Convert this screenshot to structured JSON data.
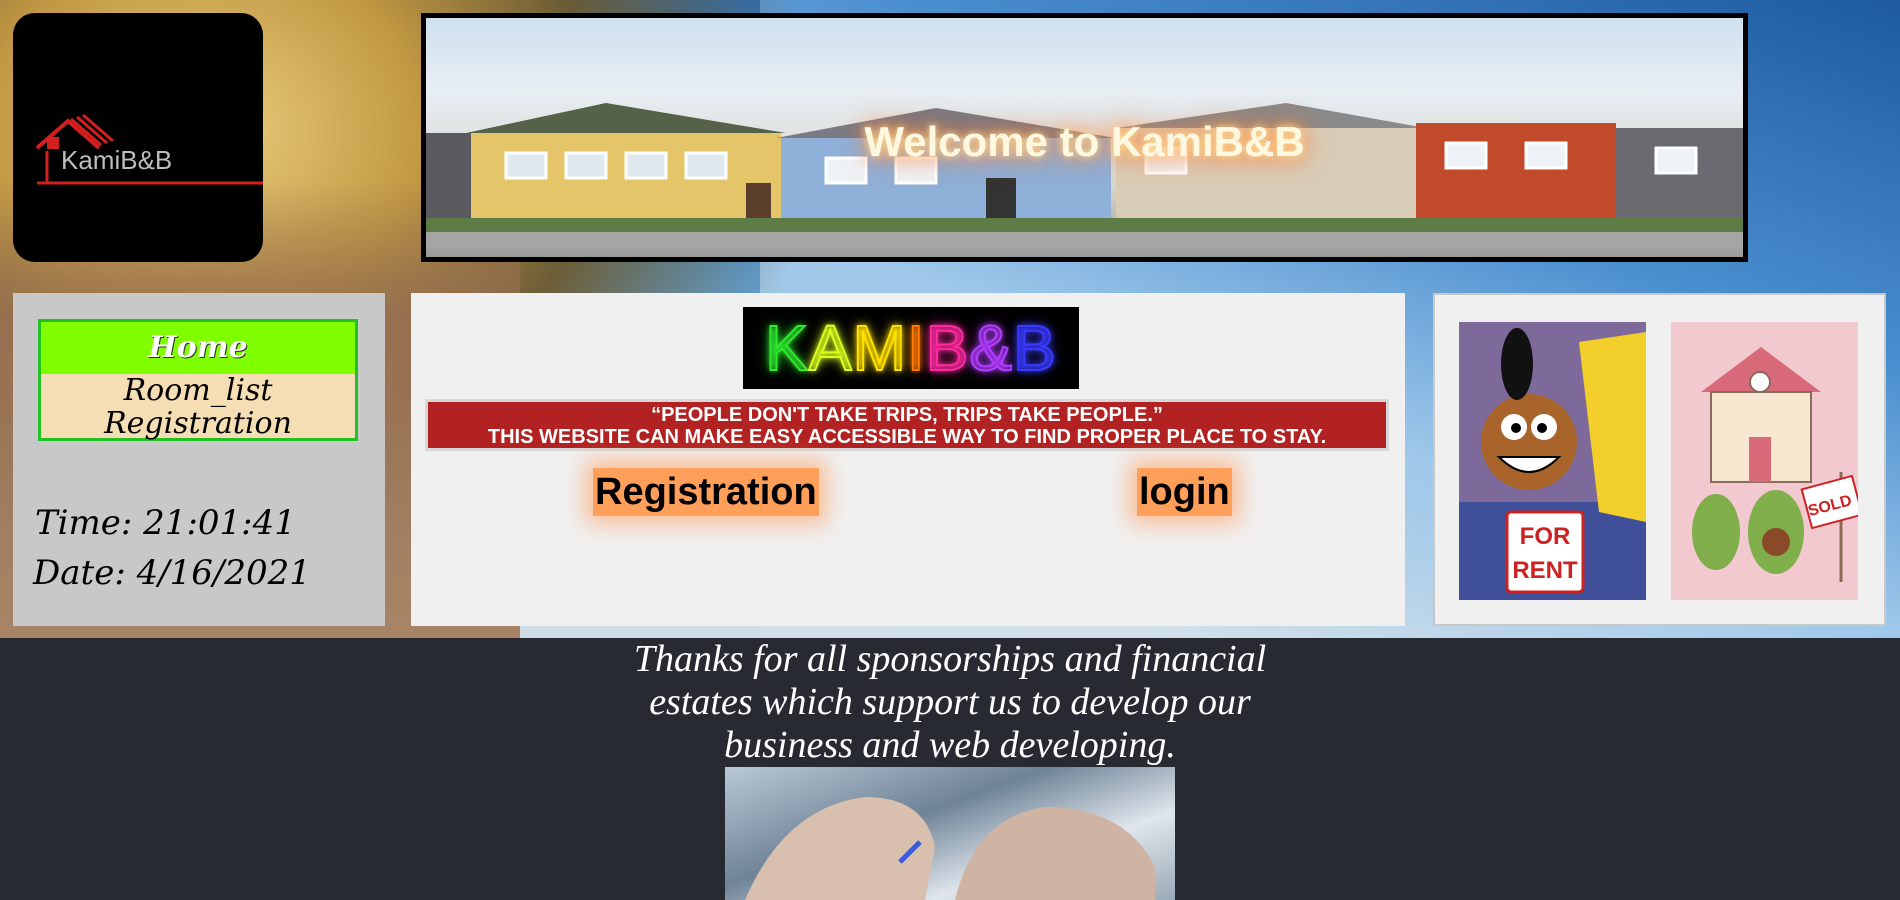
{
  "logo": {
    "text": "KamiB&B"
  },
  "banner": {
    "welcome": "Welcome to KamiB&B"
  },
  "nav": {
    "items": [
      {
        "label": "Home"
      },
      {
        "label": "Room_list"
      },
      {
        "label": "Registration"
      }
    ]
  },
  "clock": {
    "time": "Time: 21:01:41",
    "date": "Date: 4/16/2021"
  },
  "main": {
    "brand": [
      "K",
      "A",
      "M",
      "I",
      "B",
      "&",
      "B"
    ],
    "brand_colors": [
      "#2ee82e",
      "#d8ff20",
      "#ffe000",
      "#ff7a00",
      "#ff2aa0",
      "#b23cff",
      "#3a3aff"
    ],
    "quote_line1": "“PEOPLE DON'T TAKE TRIPS, TRIPS TAKE PEOPLE.”",
    "quote_line2": "THIS WEBSITE CAN MAKE EASY ACCESSIBLE WAY TO FIND PROPER PLACE TO STAY.",
    "register_button": "Registration",
    "login_button": "login"
  },
  "cards": {
    "rent_sign": "FOR RENT",
    "sold_sign": "SOLD"
  },
  "footer": {
    "thanks": "Thanks for all sponsorships and financial estates which support us to develop our business and web developing."
  },
  "colors": {
    "menu_home": "#7fff00",
    "menu_bg": "#f5deb3",
    "quote_bg": "#b22222",
    "button_bg": "#ff9f5a",
    "footer_bg": "#272b31"
  }
}
